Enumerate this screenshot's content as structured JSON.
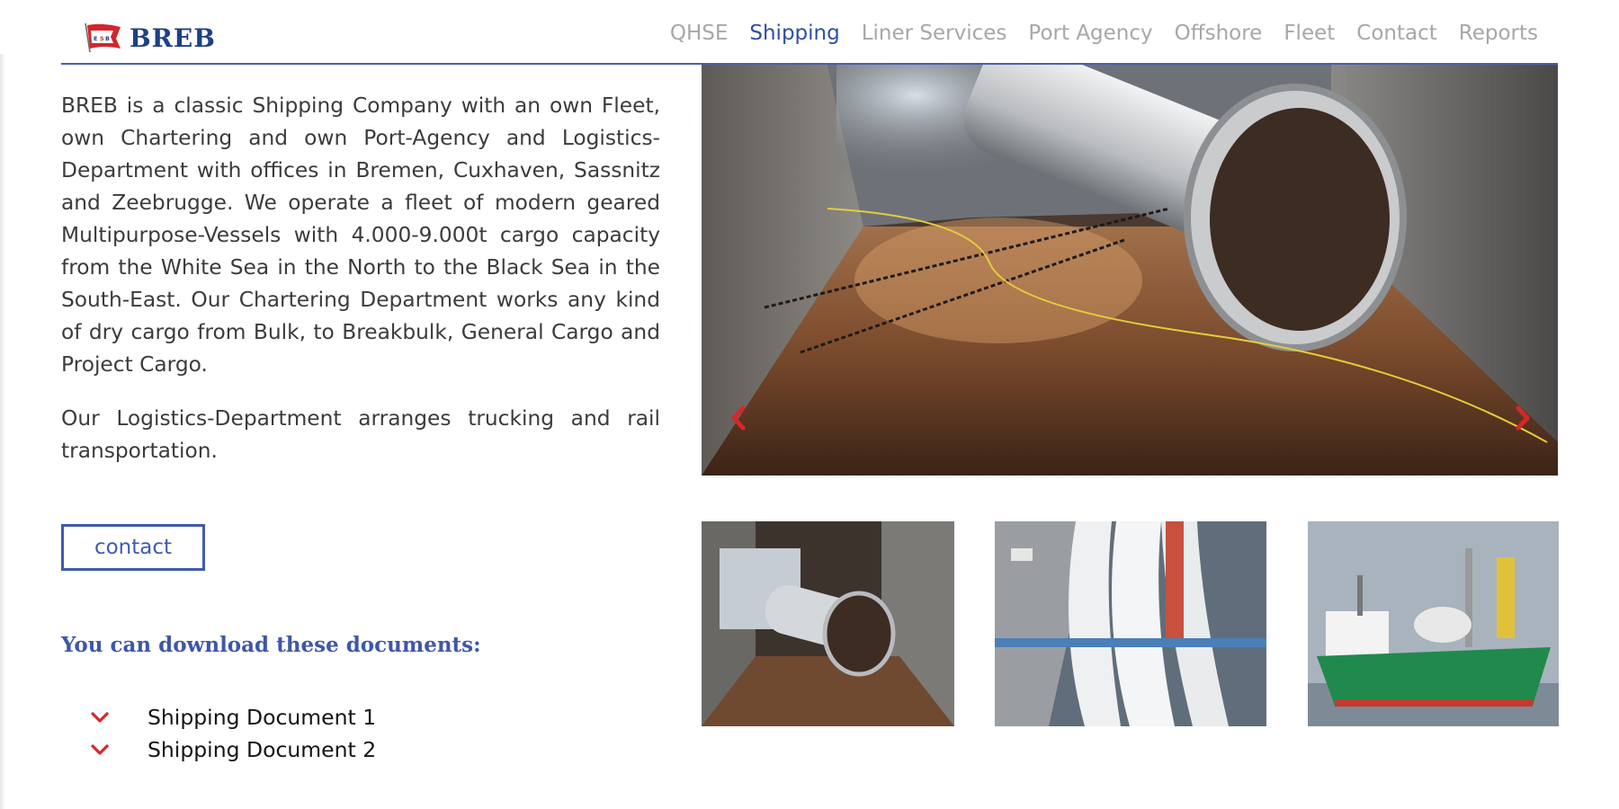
{
  "header": {
    "brand": "BREB",
    "flag_text": "E S B",
    "nav": [
      {
        "label": "QHSE",
        "active": false
      },
      {
        "label": "Shipping",
        "active": true
      },
      {
        "label": "Liner Services",
        "active": false
      },
      {
        "label": "Port Agency",
        "active": false
      },
      {
        "label": "Offshore",
        "active": false
      },
      {
        "label": "Fleet",
        "active": false
      },
      {
        "label": "Contact",
        "active": false
      },
      {
        "label": "Reports",
        "active": false
      }
    ]
  },
  "intro": {
    "paragraph1": "BREB is a classic Shipping Company with an own Fleet, own Chartering and own Port-Agency and Logistics-Department with offices in Bremen, Cuxhaven, Sassnitz and Zeebrugge. We operate a fleet of modern geared Multipurpose-Vessels with 4.000-9.000t cargo capacity from the White Sea in the North to the Black Sea in the South-East. Our Chartering Department works any kind of dry cargo from Bulk, to Breakbulk, General Cargo and Project Cargo.",
    "paragraph2": "Our Logistics-Department arranges trucking and rail transportation."
  },
  "contact_button": "contact",
  "downloads": {
    "heading": "You can download these documents:",
    "items": [
      "Shipping Document 1",
      "Shipping Document 2"
    ]
  },
  "slider": {
    "prev_icon": "chevron-left-icon",
    "next_icon": "chevron-right-icon"
  },
  "colors": {
    "brand_blue": "#1f3f86",
    "accent_blue": "#3f5bb0",
    "nav_gray": "#a7a7a7",
    "arrow_red": "#d8262b"
  }
}
